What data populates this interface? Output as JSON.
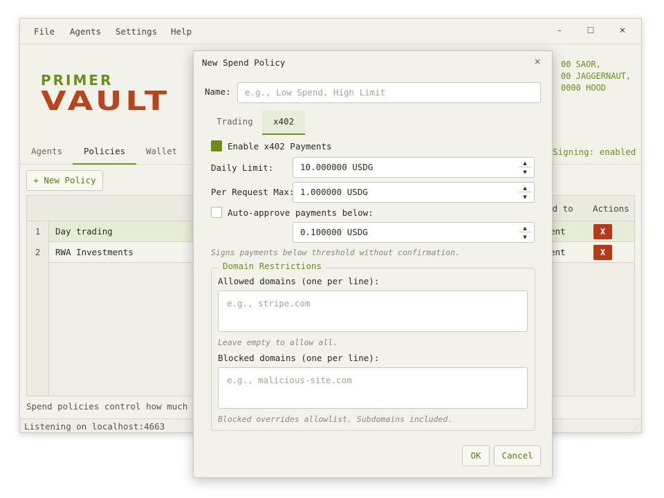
{
  "menu": [
    "File",
    "Agents",
    "Settings",
    "Help"
  ],
  "window_controls": {
    "minimize": "–",
    "maximize": "☐",
    "close": "✕"
  },
  "logo": {
    "line1": "PRIMER",
    "line2": "VAULT"
  },
  "addresses": "00 SAOR,\n00 JAGGERNAUT,\n0000 HOOD",
  "signing_status": "Signing: enabled",
  "tabs": [
    "Agents",
    "Policies",
    "Wallet"
  ],
  "new_policy_label": "+ New Policy",
  "table": {
    "headers": {
      "assigned": "ed to",
      "actions": "Actions"
    },
    "rows": [
      {
        "num": "1",
        "name": "Day trading",
        "assigned": "ent",
        "delete": "X"
      },
      {
        "num": "2",
        "name": "RWA Investments",
        "assigned": "ent",
        "delete": "X"
      }
    ]
  },
  "footnote": "Spend policies control how much age",
  "status": "Listening on localhost:4663",
  "dialog": {
    "title": "New Spend Policy",
    "close": "×",
    "name_label": "Name:",
    "name_placeholder": "e.g., Low Spend, High Limit",
    "tabs": [
      "Trading",
      "x402"
    ],
    "enable_label": "Enable x402 Payments",
    "enable_checked": true,
    "daily_limit_label": "Daily Limit:",
    "daily_limit_value": "10.000000 USDG",
    "per_request_label": "Per Request Max:",
    "per_request_value": "1.000000 USDG",
    "auto_approve_label": "Auto-approve payments below:",
    "auto_approve_checked": false,
    "auto_approve_value": "0.100000 USDG",
    "auto_hint": "Signs payments below threshold without confirmation.",
    "domain_legend": "Domain Restrictions",
    "allowed_label": "Allowed domains (one per line):",
    "allowed_placeholder": "e.g., stripe.com",
    "allowed_hint": "Leave empty to allow all.",
    "blocked_label": "Blocked domains (one per line):",
    "blocked_placeholder": "e.g., malicious-site.com",
    "blocked_hint": "Blocked overrides allowlist. Subdomains included.",
    "ok": "OK",
    "cancel": "Cancel",
    "spin_up": "▲",
    "spin_down": "▼"
  },
  "colors": {
    "accent_green": "#6e8c1a",
    "brand_rust": "#b5461e",
    "delete_red": "#b5391b"
  }
}
